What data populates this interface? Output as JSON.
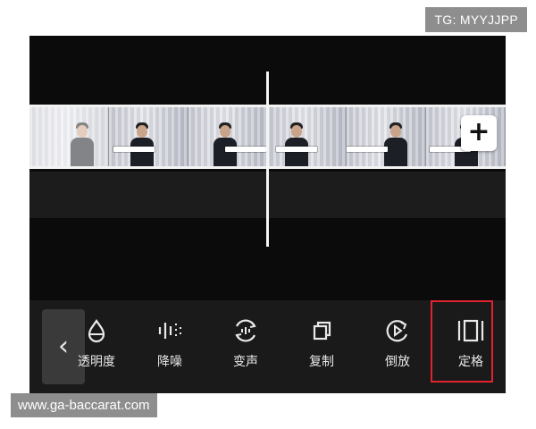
{
  "watermarks": {
    "top_right": "TG: MYYJJPP",
    "bottom_left": "www.ga-baccarat.com"
  },
  "timeline": {
    "add_button_label": "+",
    "playhead": true
  },
  "toolbar": {
    "back_label": "‹",
    "tools": [
      {
        "label": "透明度",
        "icon": "opacity-drop-icon"
      },
      {
        "label": "降噪",
        "icon": "noise-reduction-icon"
      },
      {
        "label": "变声",
        "icon": "voice-change-icon"
      },
      {
        "label": "复制",
        "icon": "copy-icon"
      },
      {
        "label": "倒放",
        "icon": "reverse-play-icon"
      },
      {
        "label": "定格",
        "icon": "freeze-frame-icon",
        "highlighted": true
      }
    ]
  },
  "colors": {
    "editor_bg": "#0b0b0b",
    "toolbar_bg": "#1a1a1a",
    "highlight": "#e0232e",
    "watermark_bg": "#8e8e8e"
  }
}
